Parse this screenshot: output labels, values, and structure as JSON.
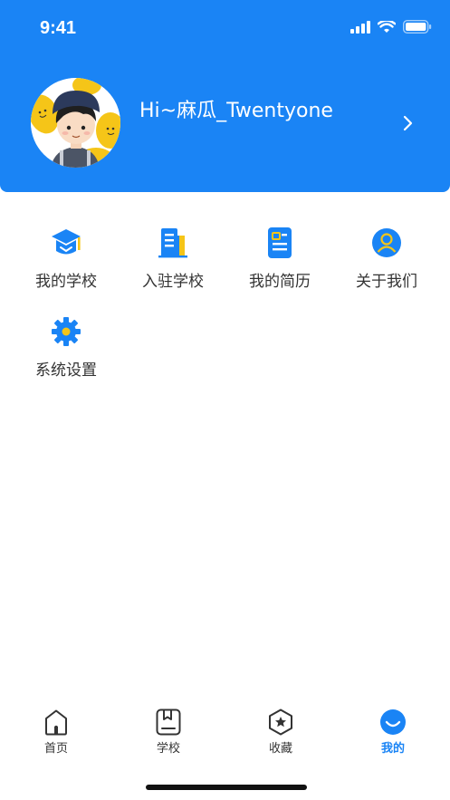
{
  "status_bar": {
    "time": "9:41"
  },
  "profile": {
    "greeting": "Hi~麻瓜_Twentyone"
  },
  "menu": {
    "items": [
      {
        "label": "我的学校",
        "icon": "graduation-cap-icon"
      },
      {
        "label": "入驻学校",
        "icon": "building-icon"
      },
      {
        "label": "我的简历",
        "icon": "resume-icon"
      },
      {
        "label": "关于我们",
        "icon": "user-circle-icon"
      },
      {
        "label": "系统设置",
        "icon": "gear-icon"
      }
    ]
  },
  "tabbar": {
    "items": [
      {
        "label": "首页",
        "icon": "home-icon"
      },
      {
        "label": "学校",
        "icon": "bookmark-book-icon"
      },
      {
        "label": "收藏",
        "icon": "star-hexagon-icon"
      },
      {
        "label": "我的",
        "icon": "smile-icon"
      }
    ],
    "active_index": 3
  },
  "colors": {
    "brand": "#1a84f5",
    "accent_yellow": "#f5c518"
  }
}
